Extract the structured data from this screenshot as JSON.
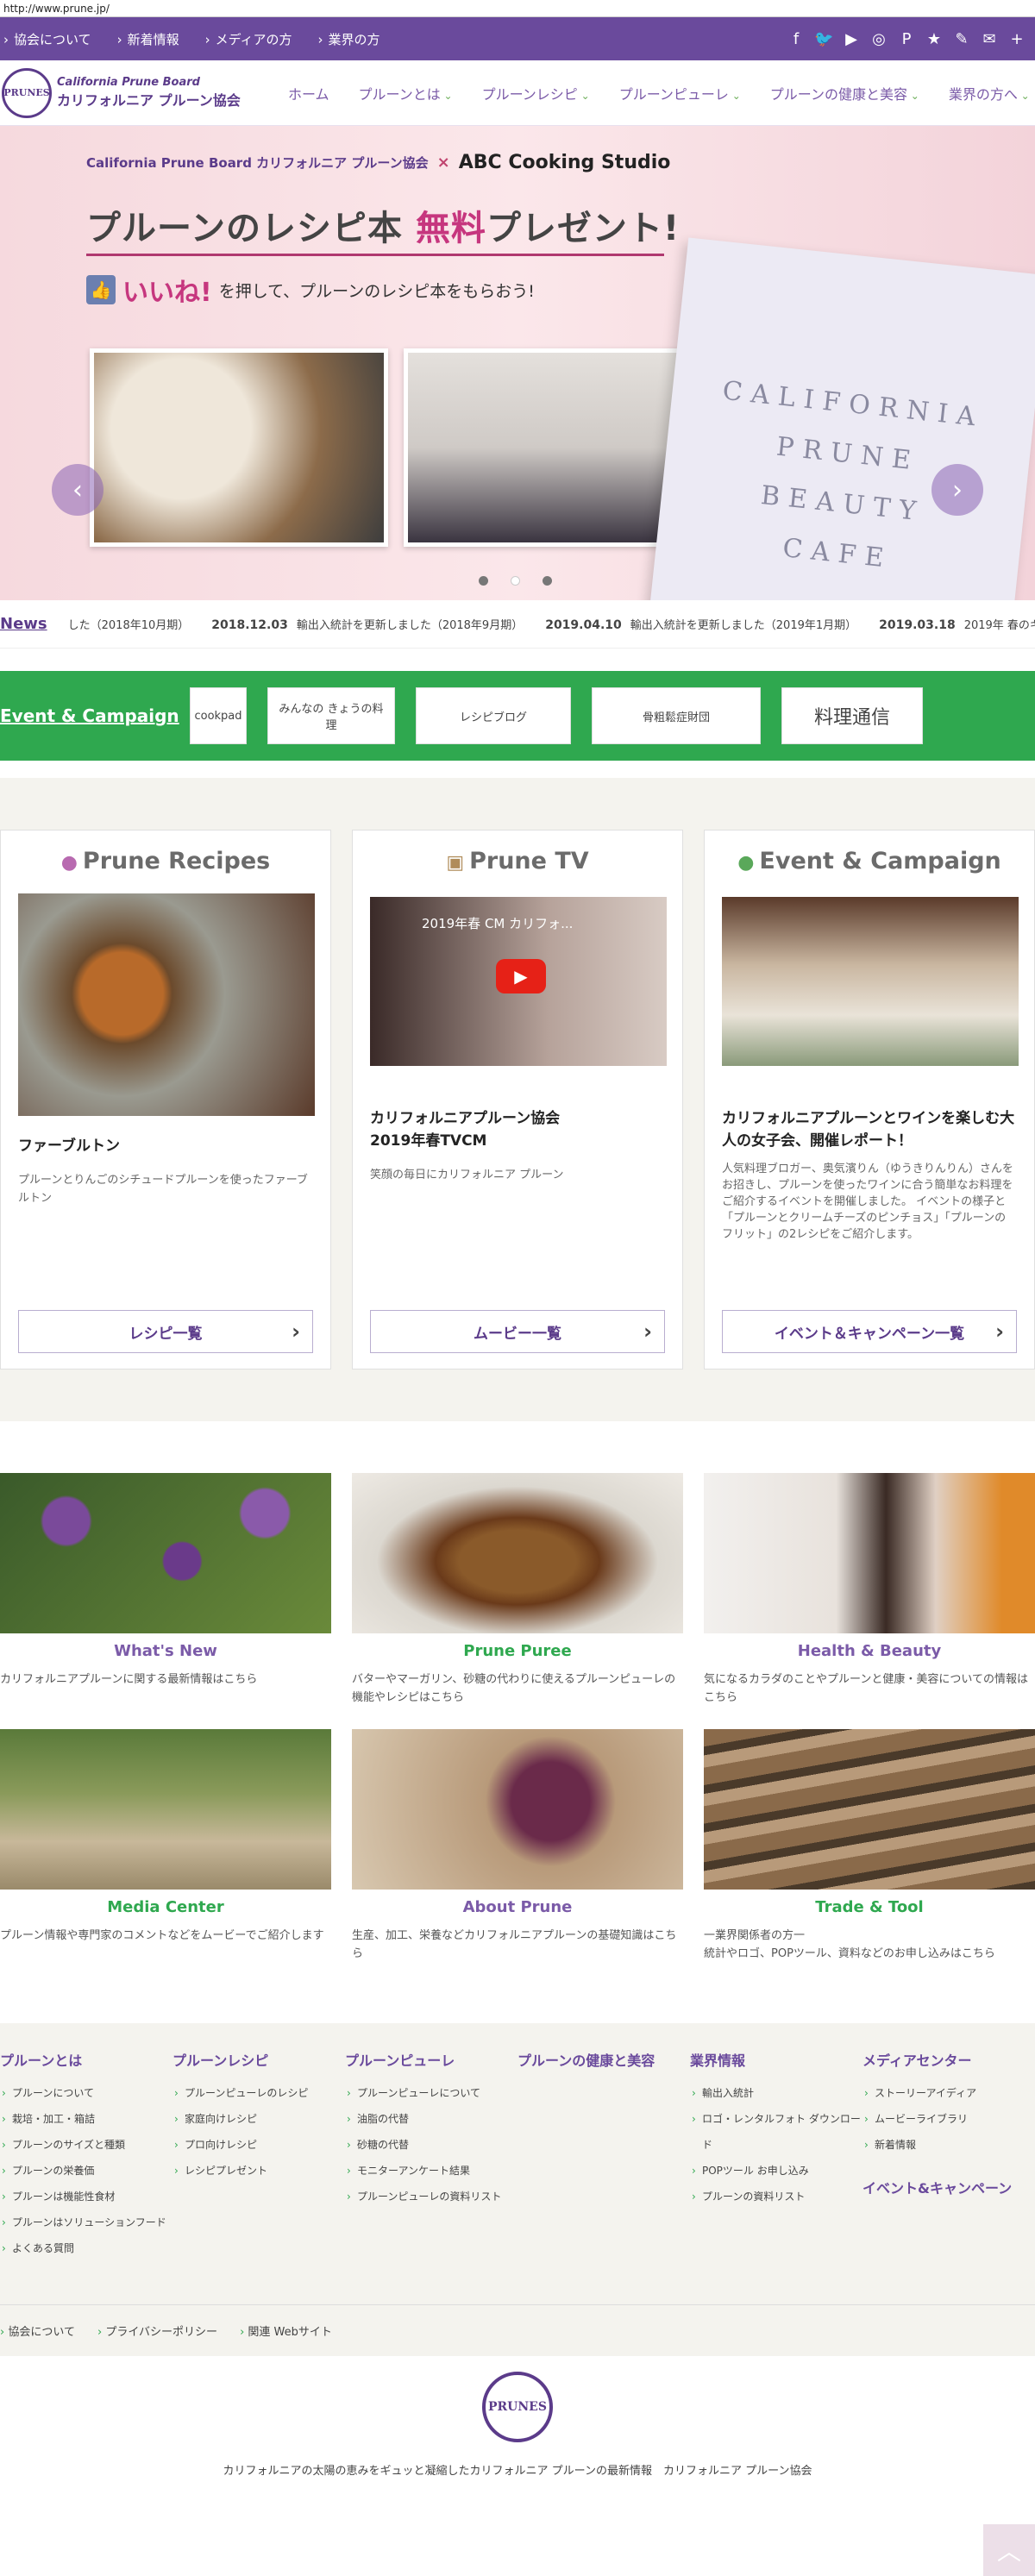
{
  "url": "http://www.prune.jp/",
  "topbar": {
    "links": [
      "協会について",
      "新着情報",
      "メディアの方",
      "業界の方"
    ],
    "social": [
      "f",
      "🐦",
      "▶",
      "◎",
      "P",
      "★",
      "✎",
      "✉",
      "+"
    ]
  },
  "header": {
    "logo_en": "California Prune Board",
    "logo_jp": "カリフォルニア プルーン協会",
    "logo_mark": "PRUNES",
    "nav": [
      "ホーム",
      "プルーンとは",
      "プルーンレシピ",
      "プルーンピューレ",
      "プルーンの健康と美容",
      "業界の方へ"
    ]
  },
  "hero": {
    "brand_left": "California Prune Board カリフォルニア プルーン協会",
    "cross": "×",
    "brand_right": "ABC Cooking Studio",
    "headline_pre": "プルーンのレシピ本 ",
    "headline_free": "無料",
    "headline_post": "プレゼント!",
    "thumb": "👍",
    "sub_like": "いいね!",
    "sub_text": "を押して、プルーンのレシピ本をもらおう!",
    "book_text": "CALIFORNIA\nPRUNE\nBEAUTY\nCAFE",
    "arrow_left": "‹",
    "arrow_right": "›"
  },
  "news": {
    "label": "News",
    "items": [
      {
        "date": "",
        "text": "した（2018年10月期）"
      },
      {
        "date": "2018.12.03",
        "text": "輸出入統計を更新しました（2018年9月期）"
      },
      {
        "date": "2019.04.10",
        "text": "輸出入統計を更新しました（2019年1月期）"
      },
      {
        "date": "2019.03.18",
        "text": "2019年 春のキ"
      }
    ]
  },
  "event": {
    "label": "Event & Campaign",
    "banners": [
      "cookpad",
      "みんなの きょうの料理",
      "レシピブログ",
      "骨粗鬆症財団",
      "料理通信"
    ]
  },
  "panels": [
    {
      "icon": "●",
      "heading": "Prune Recipes",
      "title": "ファーブルトン",
      "desc": "プルーンとりんごのシチュードプルーンを使ったファーブルトン",
      "button": "レシピ一覧"
    },
    {
      "icon": "▣",
      "heading": "Prune TV",
      "title": "カリフォルニアプルーン協会\n2019年春TVCM",
      "desc": "笑顔の毎日にカリフォルニア プルーン",
      "video_title": "2019年春 CM カリフォ...",
      "button": "ムービー一覧"
    },
    {
      "icon": "●",
      "heading": "Event & Campaign",
      "title": "カリフォルニアプルーンとワインを楽しむ大人の女子会、開催レポート！",
      "desc": "人気料理ブロガー、奥気濱りん（ゆうきりんりん）さんをお招きし、プルーンを使ったワインに合う簡単なお料理をご紹介するイベントを開催しました。 イベントの様子と「プルーンとクリームチーズのピンチョス」「プルーンのフリット」の2レシピをご紹介します。",
      "button": "イベント＆キャンペーン一覧"
    }
  ],
  "tiles": [
    {
      "name": "What's New",
      "color": "#7b5ba8",
      "desc": "カリフォルニアプルーンに関する最新情報はこちら"
    },
    {
      "name": "Prune Puree",
      "color": "#2fa84f",
      "desc": "バターやマーガリン、砂糖の代わりに使えるプルーンピューレの機能やレシピはこちら"
    },
    {
      "name": "Health & Beauty",
      "color": "#7b5ba8",
      "desc": "気になるカラダのことやプルーンと健康・美容についての情報はこちら"
    },
    {
      "name": "Media Center",
      "color": "#2fa84f",
      "desc": "プルーン情報や専門家のコメントなどをムービーでご紹介します"
    },
    {
      "name": "About Prune",
      "color": "#7b5ba8",
      "desc": "生産、加工、栄養などカリフォルニアプルーンの基礎知識はこちら"
    },
    {
      "name": "Trade & Tool",
      "color": "#2fa84f",
      "desc": "一業界関係者の方一\n統計やロゴ、POPツール、資料などのお申し込みはこちら"
    }
  ],
  "footer": {
    "cols": [
      {
        "title": "プルーンとは",
        "items": [
          "プルーンについて",
          "栽培・加工・箱詰",
          "プルーンのサイズと種類",
          "プルーンの栄養価",
          "プルーンは機能性食材",
          "プルーンはソリューションフード",
          "よくある質問"
        ]
      },
      {
        "title": "プルーンレシピ",
        "items": [
          "プルーンピューレのレシピ",
          "家庭向けレシピ",
          "プロ向けレシピ",
          "レシピプレゼント"
        ]
      },
      {
        "title": "プルーンピューレ",
        "items": [
          "プルーンピューレについて",
          "油脂の代替",
          "砂糖の代替",
          "モニターアンケート結果",
          "プルーンピューレの資料リスト"
        ]
      },
      {
        "title": "プルーンの健康と美容",
        "items": []
      },
      {
        "title": "業界情報",
        "items": [
          "輸出入統計",
          "ロゴ・レンタルフォト ダウンロード",
          "POPツール お申し込み",
          "プルーンの資料リスト"
        ]
      },
      {
        "title": "メディアセンター",
        "items": [
          "ストーリーアイディア",
          "ムービーライブラリ",
          "新着情報"
        ],
        "extra": "イベント&キャンペーン"
      }
    ],
    "bottom_links": [
      "協会について",
      "プライバシーポリシー",
      "関連 Webサイト"
    ],
    "brand_mark": "PRUNES",
    "tagline": "カリフォルニアの太陽の恵みをギュッと凝縮したカリフォルニア プルーンの最新情報　カリフォルニア プルーン協会",
    "to_top": "︿"
  }
}
